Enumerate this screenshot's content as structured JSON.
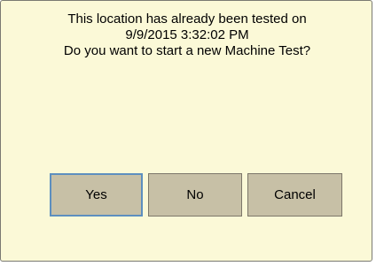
{
  "dialog": {
    "message_lines": [
      "This location has already been tested on",
      "9/9/2015 3:32:02 PM",
      "Do you want to start a new Machine Test?"
    ],
    "buttons": {
      "yes": "Yes",
      "no": "No",
      "cancel": "Cancel"
    }
  },
  "colors": {
    "background": "#fbf9d7",
    "button_face": "#c7c0a6",
    "focus_border": "#5d8fbf"
  }
}
